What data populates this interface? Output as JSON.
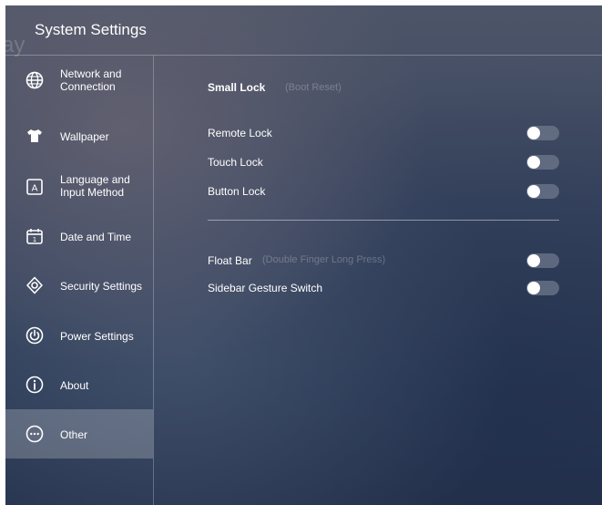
{
  "watermark": "ay",
  "header": {
    "title": "System Settings"
  },
  "sidebar": {
    "items": [
      {
        "label": "Network and\nConnection",
        "icon": "globe-icon"
      },
      {
        "label": "Wallpaper",
        "icon": "shirt-icon"
      },
      {
        "label": "Language and\nInput Method",
        "icon": "language-icon"
      },
      {
        "label": "Date and Time",
        "icon": "calendar-icon"
      },
      {
        "label": "Security Settings",
        "icon": "shield-icon"
      },
      {
        "label": "Power Settings",
        "icon": "power-icon"
      },
      {
        "label": "About",
        "icon": "info-icon"
      },
      {
        "label": "Other",
        "icon": "more-icon",
        "selected": true
      }
    ]
  },
  "main": {
    "small_lock": {
      "title": "Small Lock",
      "hint": "(Boot Reset)"
    },
    "lock_toggles": [
      {
        "label": "Remote Lock",
        "on": false
      },
      {
        "label": "Touch Lock",
        "on": false
      },
      {
        "label": "Button Lock",
        "on": false
      }
    ],
    "float_bar": {
      "label": "Float Bar",
      "hint": "(Double Finger Long Press)",
      "on": false
    },
    "sidebar_gesture": {
      "label": "Sidebar Gesture Switch",
      "on": false
    }
  },
  "colors": {
    "background": "#2f3d58",
    "selected_item": "#5d6780",
    "toggle_track": "#6e788c",
    "toggle_knob": "#ffffff"
  }
}
